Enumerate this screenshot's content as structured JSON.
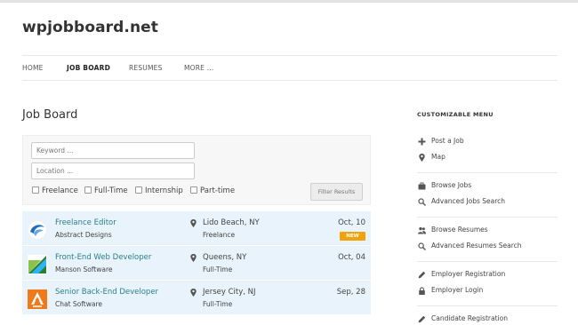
{
  "site": {
    "title": "wpjobboard.net"
  },
  "nav": {
    "items": [
      {
        "label": "HOME"
      },
      {
        "label": "JOB BOARD"
      },
      {
        "label": "RESUMES"
      },
      {
        "label": "MORE ..."
      }
    ],
    "active": "JOB BOARD"
  },
  "page": {
    "title": "Job Board"
  },
  "search": {
    "keyword_placeholder": "Keyword ...",
    "location_placeholder": "Location ...",
    "types": [
      "Freelance",
      "Full-Time",
      "Internship",
      "Part-time"
    ],
    "filter_button": "Filter Results"
  },
  "jobs": [
    {
      "title": "Freelance Editor",
      "company": "Abstract Designs",
      "location": "Lido Beach, NY",
      "type": "Freelance",
      "date": "Oct, 10",
      "badge": "NEW",
      "logo": "abstract-designs-logo",
      "logo_color": "#1f6fb8"
    },
    {
      "title": "Front-End Web Developer",
      "company": "Manson Software",
      "location": "Queens, NY",
      "type": "Full-Time",
      "date": "Oct, 04",
      "logo": "manson-software-logo",
      "logo_color": "#4caf50"
    },
    {
      "title": "Senior Back-End Developer",
      "company": "Chat Software",
      "location": "Jersey City, NJ",
      "type": "Full-Time",
      "date": "Sep, 28",
      "logo": "chat-software-logo",
      "logo_color": "#f07a1a"
    }
  ],
  "sidebar": {
    "heading": "CUSTOMIZABLE MENU",
    "items": [
      {
        "label": "Post a Job",
        "icon": "plus-icon"
      },
      {
        "label": "Map",
        "icon": "map-marker-icon"
      },
      {
        "label": "Browse Jobs",
        "icon": "briefcase-icon"
      },
      {
        "label": "Advanced Jobs Search",
        "icon": "search-icon"
      },
      {
        "label": "Browse Resumes",
        "icon": "users-icon"
      },
      {
        "label": "Advanced Resumes Search",
        "icon": "search-icon"
      },
      {
        "label": "Employer Registration",
        "icon": "pencil-icon"
      },
      {
        "label": "Employer Login",
        "icon": "lock-icon"
      },
      {
        "label": "Candidate Registration",
        "icon": "pencil-icon"
      }
    ]
  },
  "colors": {
    "link": "#2a7f8a",
    "row_background": "#e9f3fb",
    "badge": "#f0a30a"
  }
}
